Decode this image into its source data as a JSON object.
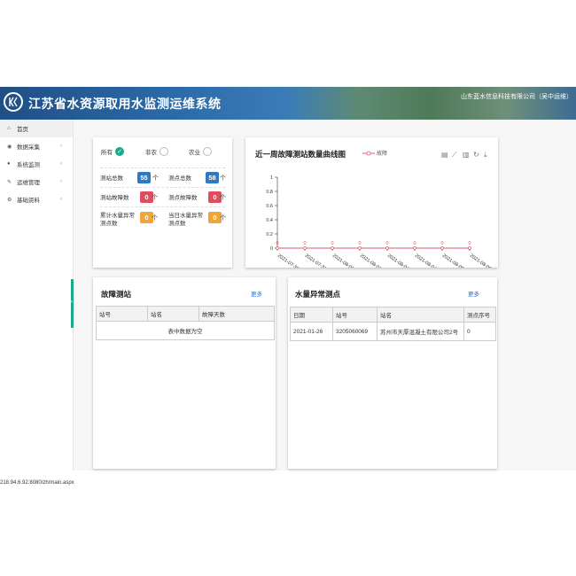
{
  "header": {
    "title": "江苏省水资源取用水监测运维系统",
    "company": "山东蓝水信息科技有限公司（吴中运维）"
  },
  "sidebar": {
    "items": [
      {
        "label": "首页",
        "icon": "home-icon",
        "glyph": "⌂"
      },
      {
        "label": "数据采集",
        "icon": "rss-icon",
        "glyph": "◉",
        "arrow": "‹"
      },
      {
        "label": "系统监测",
        "icon": "user-icon",
        "glyph": "●",
        "arrow": "‹"
      },
      {
        "label": "运维管理",
        "icon": "wrench-icon",
        "glyph": "✎",
        "arrow": "‹"
      },
      {
        "label": "基础资料",
        "icon": "gear-icon",
        "glyph": "⚙",
        "arrow": "‹"
      }
    ]
  },
  "filters": {
    "all": "所有",
    "non_agri": "非农",
    "agri": "农业"
  },
  "stats": {
    "unit": "个",
    "station_total": {
      "label": "测站总数",
      "value": "55"
    },
    "point_total": {
      "label": "测点总数",
      "value": "58"
    },
    "station_fault": {
      "label": "测站故障数",
      "value": "0"
    },
    "point_fault": {
      "label": "测点故障数",
      "value": "0"
    },
    "cum_abnormal": {
      "label": "累计水量异常测点数",
      "value": "0"
    },
    "today_abnormal": {
      "label": "当日水量异常测点数",
      "value": "0"
    }
  },
  "chart_card": {
    "title": "近一周故障测站数量曲线图"
  },
  "chart_data": {
    "type": "line",
    "x": [
      "2021-07-30",
      "2021-07-31",
      "2021-08-01",
      "2021-08-02",
      "2021-08-03",
      "2021-08-04",
      "2021-08-05",
      "2021-08-06"
    ],
    "series": [
      {
        "name": "故障",
        "values": [
          0,
          0,
          0,
          0,
          0,
          0,
          0,
          0
        ],
        "color": "#e05a6a"
      }
    ],
    "yticks": [
      "0",
      "0.2",
      "0.4",
      "0.6",
      "0.8",
      "1"
    ],
    "ylim": [
      0,
      1
    ],
    "grid": false,
    "legend": "top"
  },
  "fault_card": {
    "title": "故障测站",
    "more": "更多",
    "columns": [
      "站号",
      "站名",
      "故障天数"
    ],
    "empty": "表中数据为空"
  },
  "abnormal_card": {
    "title": "水量异常测点",
    "more": "更多",
    "columns": [
      "日期",
      "站号",
      "站名",
      "测点序号"
    ],
    "rows": [
      [
        "2021-01-26",
        "3205060069",
        "苏州市天厚混凝土有限公司2号",
        "0"
      ]
    ]
  },
  "status_url": "218.94.6.92:8080/zh/main.aspx",
  "colors": {
    "blue": "#2f78c4",
    "red": "#e04e5e",
    "orange": "#f0a53a",
    "teal": "#1aaa8a"
  }
}
